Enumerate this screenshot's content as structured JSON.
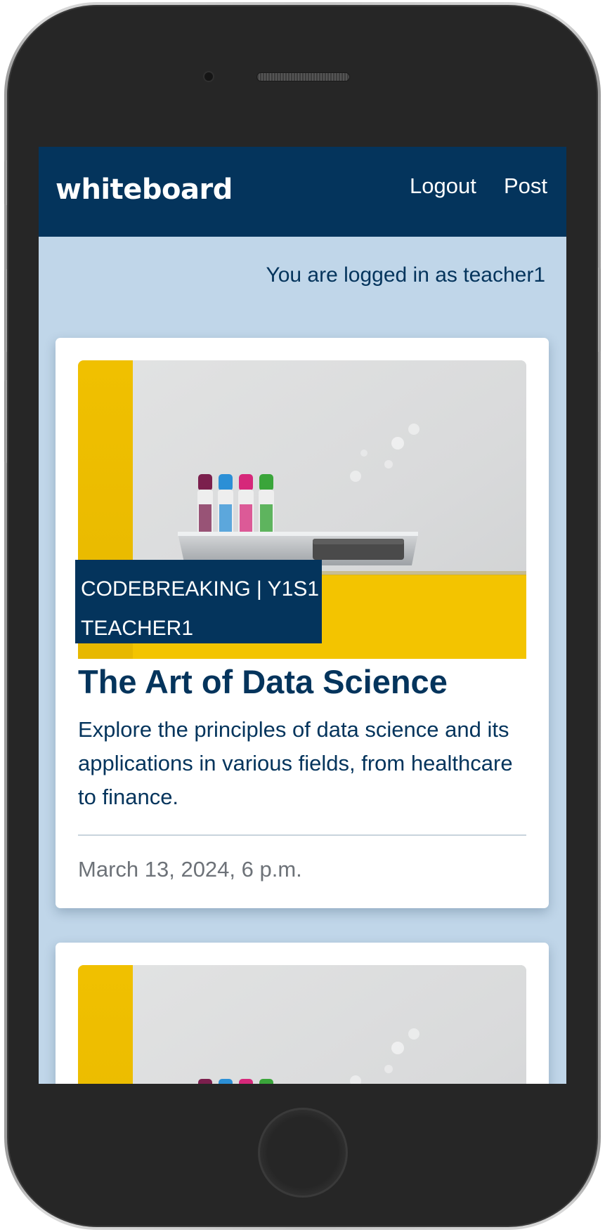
{
  "app": {
    "brand": "whiteboard"
  },
  "navbar": {
    "links": [
      {
        "label": "Logout"
      },
      {
        "label": "Post"
      }
    ],
    "background_color": "#04345c"
  },
  "login_status": "You are logged in as teacher1",
  "page_background_color": "#c0d6e9",
  "posts": [
    {
      "tag_line_1": "CODEBREAKING | Y1S1",
      "tag_line_2": "TEACHER1",
      "title": "The Art of Data Science",
      "description": "Explore the principles of data science and its applications in various fields, from healthcare to finance.",
      "date": "March 13, 2024, 6 p.m.",
      "image_subject": "whiteboard-with-markers-photo"
    },
    {
      "image_subject": "whiteboard-with-markers-photo"
    }
  ],
  "device": {
    "frame": "phone",
    "home_button_icon": "home-button-icon"
  }
}
